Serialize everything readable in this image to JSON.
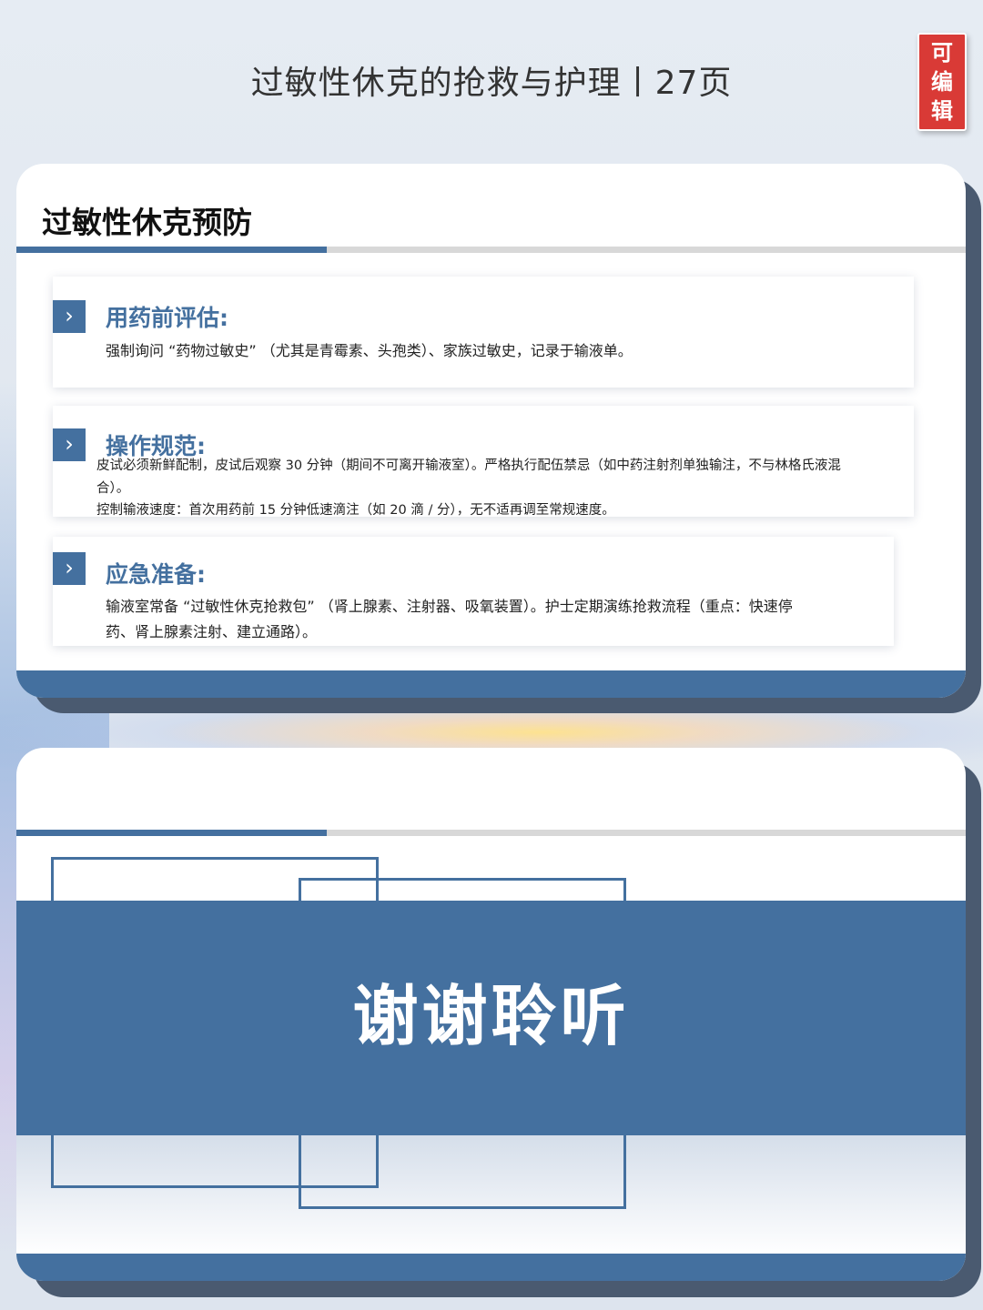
{
  "header": {
    "title": "过敏性休克的抢救与护理丨27页"
  },
  "badge": {
    "chars": [
      "可",
      "编",
      "辑"
    ]
  },
  "slide1": {
    "title": "过敏性休克预防",
    "cards": [
      {
        "title": "用药前评估:",
        "lines": [
          "强制询问 “药物过敏史” （尤其是青霉素、头孢类）、家族过敏史，记录于输液单。"
        ]
      },
      {
        "title": "操作规范:",
        "lines": [
          "皮试必须新鲜配制，皮试后观察 30 分钟（期间不可离开输液室）。严格执行配伍禁忌（如中药注射剂单独输注，不与林格氏液混",
          "合）。",
          "控制输液速度：首次用药前 15 分钟低速滴注（如 20 滴 / 分），无不适再调至常规速度。"
        ]
      },
      {
        "title": "应急准备:",
        "lines": [
          "输液室常备 “过敏性休克抢救包” （肾上腺素、注射器、吸氧装置）。护士定期演练抢救流程（重点：快速停",
          "药、肾上腺素注射、建立通路）。"
        ]
      }
    ]
  },
  "slide2": {
    "text": "谢谢聆听"
  },
  "icons": {
    "chevron": "chevron-right-icon"
  },
  "colors": {
    "accent": "#44709f",
    "badge": "#d93a36"
  }
}
